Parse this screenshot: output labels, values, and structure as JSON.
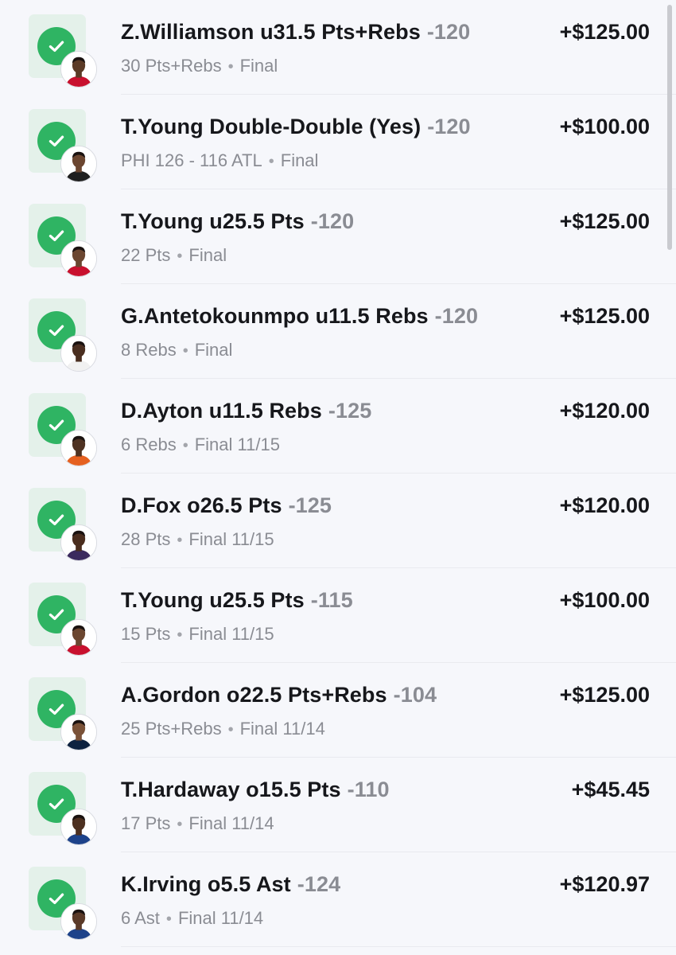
{
  "colors": {
    "win_green": "#2fb463",
    "tile_bg": "#e4f1ea",
    "text_primary": "#16171b",
    "text_secondary": "#8a8c93",
    "background": "#f6f7fb"
  },
  "separator": "•",
  "bets": [
    {
      "title": "Z.Williamson u31.5 Pts+Rebs",
      "odds": "-120",
      "result": "30 Pts+Rebs",
      "status": "Final",
      "payout": "+$125.00",
      "status_icon": "check-icon",
      "avatar": "player-avatar",
      "skin": "#5b3a26",
      "jersey": "#c8102e"
    },
    {
      "title": "T.Young Double-Double (Yes)",
      "odds": "-120",
      "result": "PHI 126 - 116 ATL",
      "status": "Final",
      "payout": "+$100.00",
      "status_icon": "check-icon",
      "avatar": "player-avatar",
      "skin": "#6b4630",
      "jersey": "#1f1f1f"
    },
    {
      "title": "T.Young u25.5 Pts",
      "odds": "-120",
      "result": "22 Pts",
      "status": "Final",
      "payout": "+$125.00",
      "status_icon": "check-icon",
      "avatar": "player-avatar",
      "skin": "#6b4630",
      "jersey": "#c8102e"
    },
    {
      "title": "G.Antetokounmpo u11.5 Rebs",
      "odds": "-120",
      "result": "8 Rebs",
      "status": "Final",
      "payout": "+$125.00",
      "status_icon": "check-icon",
      "avatar": "player-avatar",
      "skin": "#4a2f20",
      "jersey": "#f1f1f1"
    },
    {
      "title": "D.Ayton u11.5 Rebs",
      "odds": "-125",
      "result": "6 Rebs",
      "status": "Final 11/15",
      "payout": "+$120.00",
      "status_icon": "check-icon",
      "avatar": "player-avatar",
      "skin": "#4e3222",
      "jersey": "#e56020"
    },
    {
      "title": "D.Fox o26.5 Pts",
      "odds": "-125",
      "result": "28 Pts",
      "status": "Final 11/15",
      "payout": "+$120.00",
      "status_icon": "check-icon",
      "avatar": "player-avatar",
      "skin": "#4a2d1e",
      "jersey": "#3b2a5e"
    },
    {
      "title": "T.Young u25.5 Pts",
      "odds": "-115",
      "result": "15 Pts",
      "status": "Final 11/15",
      "payout": "+$100.00",
      "status_icon": "check-icon",
      "avatar": "player-avatar",
      "skin": "#6b4630",
      "jersey": "#c8102e"
    },
    {
      "title": "A.Gordon o22.5 Pts+Rebs",
      "odds": "-104",
      "result": "25 Pts+Rebs",
      "status": "Final 11/14",
      "payout": "+$125.00",
      "status_icon": "check-icon",
      "avatar": "player-avatar",
      "skin": "#7a5238",
      "jersey": "#0e2240"
    },
    {
      "title": "T.Hardaway o15.5 Pts",
      "odds": "-110",
      "result": "17 Pts",
      "status": "Final 11/14",
      "payout": "+$45.45",
      "status_icon": "check-icon",
      "avatar": "player-avatar",
      "skin": "#4d3020",
      "jersey": "#1d428a"
    },
    {
      "title": "K.Irving o5.5 Ast",
      "odds": "-124",
      "result": "6 Ast",
      "status": "Final 11/14",
      "payout": "+$120.97",
      "status_icon": "check-icon",
      "avatar": "player-avatar",
      "skin": "#5a3a28",
      "jersey": "#1d428a"
    }
  ]
}
